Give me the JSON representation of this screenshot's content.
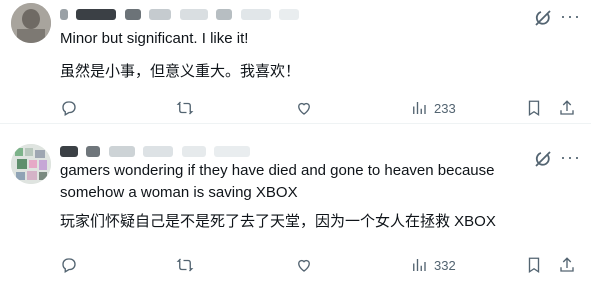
{
  "tweets": [
    {
      "text_en": "Minor but significant. I like it!",
      "text_zh": "虽然是小事，但意义重大。我喜欢！",
      "views": "233"
    },
    {
      "text_en": "gamers wondering if they have died and gone to heaven because somehow a woman is saving XBOX",
      "text_zh": "玩家们怀疑自己是不是死了去了天堂，因为一个女人在拯救 XBOX",
      "views": "332"
    }
  ],
  "icons": [
    "reply-icon",
    "retweet-icon",
    "like-icon",
    "views-icon",
    "bookmark-icon",
    "share-icon",
    "grok-icon",
    "more-icon"
  ],
  "colors": {
    "text": "#0f1419",
    "muted": "#536471",
    "divider": "#eff3f4"
  }
}
